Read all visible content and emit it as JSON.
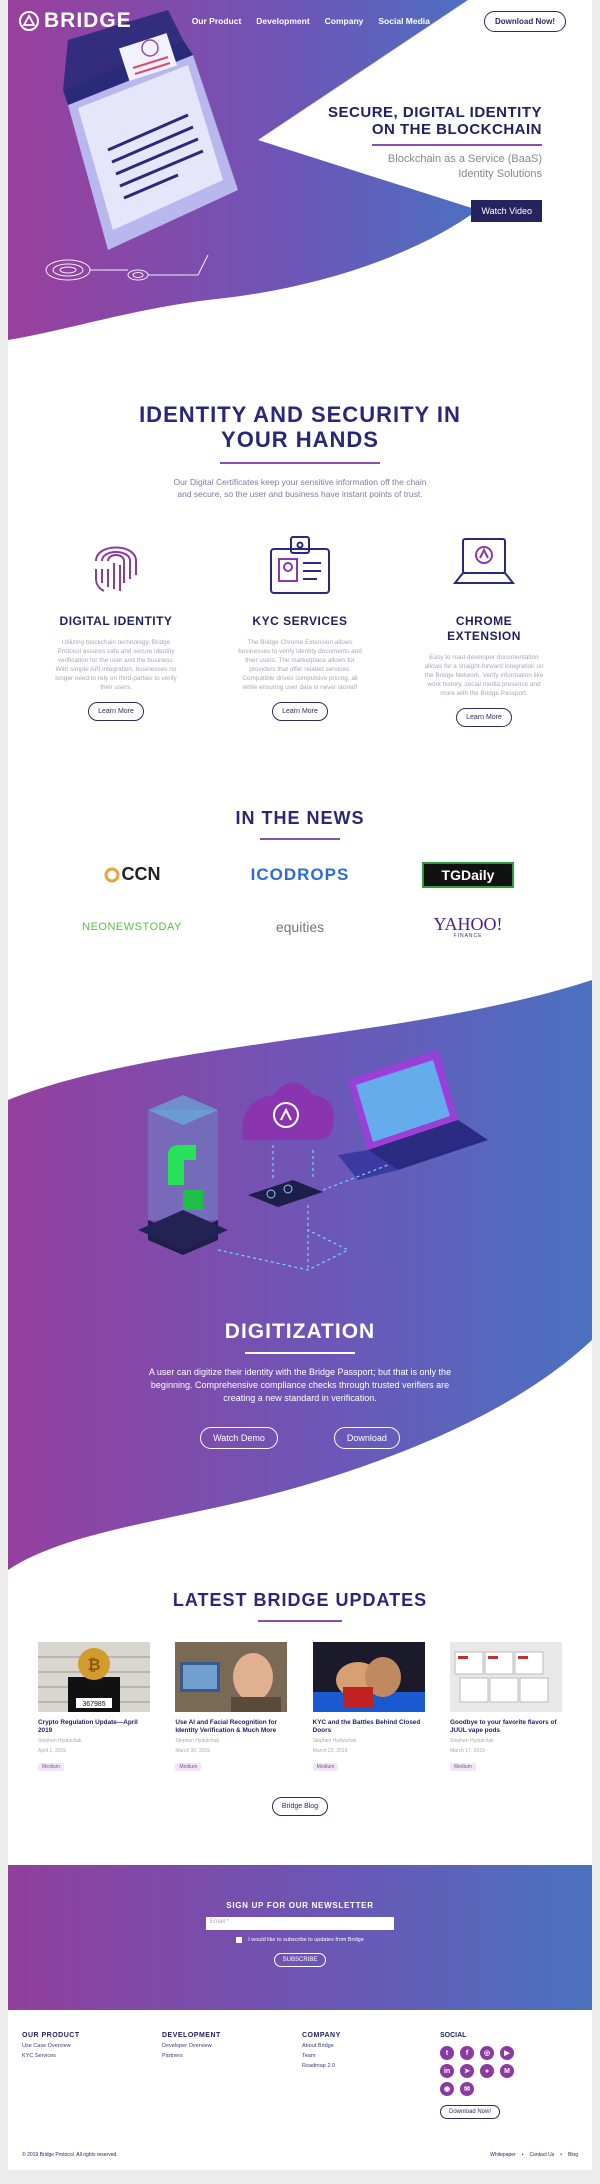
{
  "nav": {
    "logo": "BRIDGE",
    "links": [
      "Our Product",
      "Development",
      "Company",
      "Social Media"
    ],
    "download": "Download Now!"
  },
  "hero": {
    "title_line1": "SECURE, DIGITAL IDENTITY",
    "title_line2": "ON THE BLOCKCHAIN",
    "subtitle_line1": "Blockchain as a Service (BaaS)",
    "subtitle_line2": "Identity Solutions",
    "watch_video": "Watch Video"
  },
  "identity": {
    "title_line1": "IDENTITY AND SECURITY IN",
    "title_line2": "YOUR HANDS",
    "desc": "Our Digital Certificates keep your sensitive information off the chain and secure, so the user and business have instant points of trust.",
    "features": [
      {
        "title": "DIGITAL IDENTITY",
        "desc": "Utilizing blockchain technology, Bridge Protocol assures safe and secure identity verification for the user and the business. With simple API integration, businesses no longer need to rely on third-parties to verify their users.",
        "button": "Learn More",
        "icon": "fingerprint-icon"
      },
      {
        "title": "KYC SERVICES",
        "desc": "The Bridge Chrome Extension allows businesses to verify identity documents and their users. The marketplace allows for providers that offer related services. Compatible drives compulsive pricing, all while ensuring user data is never stored!",
        "button": "Learn More",
        "icon": "id-badge-icon"
      },
      {
        "title": "CHROME EXTENSION",
        "desc": "Easy to read developer documentation allows for a straight-forward integration on the Bridge Network. Verify information like work history, social media presence and more with the Bridge Passport.",
        "button": "Learn More",
        "icon": "laptop-icon"
      }
    ]
  },
  "news": {
    "title": "IN THE NEWS",
    "logos": [
      "CCN",
      "ICODROPS",
      "TGDaily",
      "NEONEWSTODAY",
      "equities",
      "YAHOO!"
    ],
    "yahoo_sub": "FINANCE"
  },
  "digitization": {
    "title": "DIGITIZATION",
    "desc": "A user can digitize their identity with the Bridge Passport; but that is only the beginning. Comprehensive compliance checks through trusted verifiers are creating a new standard in verification.",
    "watch_demo": "Watch Demo",
    "download": "Download"
  },
  "updates": {
    "title": "LATEST BRIDGE UPDATES",
    "posts": [
      {
        "title": "Crypto Regulation Update—April 2019",
        "author": "Stephen Hydutchak",
        "date": "April 1, 2019",
        "tag": "Medium"
      },
      {
        "title": "Use AI and Facial Recognition for Identity Verification & Much More",
        "author": "Stephen Hydutchak",
        "date": "March 30, 2019",
        "tag": "Medium"
      },
      {
        "title": "KYC and the Battles Behind Closed Doors",
        "author": "Stephen Hydutchak",
        "date": "March 22, 2019",
        "tag": "Medium"
      },
      {
        "title": "Goodbye to your favorite flavors of JUUL vape pods",
        "author": "Stephen Hydutchak",
        "date": "March 17, 2019",
        "tag": "Medium"
      }
    ],
    "blog_button": "Bridge Blog",
    "mugshot_number": "367985"
  },
  "newsletter": {
    "title": "SIGN UP FOR OUR NEWSLETTER",
    "email_placeholder": "Email *",
    "checkbox_label": "I would like to subscribe to updates from Bridge",
    "subscribe": "SUBSCRIBE"
  },
  "footer": {
    "columns": [
      {
        "title": "OUR PRODUCT",
        "links": [
          "Use Case Overview",
          "KYC Services"
        ]
      },
      {
        "title": "DEVELOPMENT",
        "links": [
          "Developer Overview",
          "Partners"
        ]
      },
      {
        "title": "COMPANY",
        "links": [
          "About Bridge",
          "Team",
          "Roadmap 2.0"
        ]
      }
    ],
    "social_title": "SOCIAL",
    "social_icons": [
      "twitter-icon",
      "facebook-icon",
      "instagram-icon",
      "youtube-icon",
      "linkedin-icon",
      "telegram-icon",
      "reddit-icon",
      "medium-icon",
      "github-icon",
      "email-icon"
    ],
    "download": "Download Now!",
    "copyright": "© 2019 Bridge Protocol. All rights reserved.",
    "bottom_links": [
      "Whitepaper",
      "Contact Us",
      "Blog"
    ]
  },
  "colors": {
    "purple": "#913f9c",
    "blue": "#4a72bf",
    "navy": "#1f1f62"
  }
}
